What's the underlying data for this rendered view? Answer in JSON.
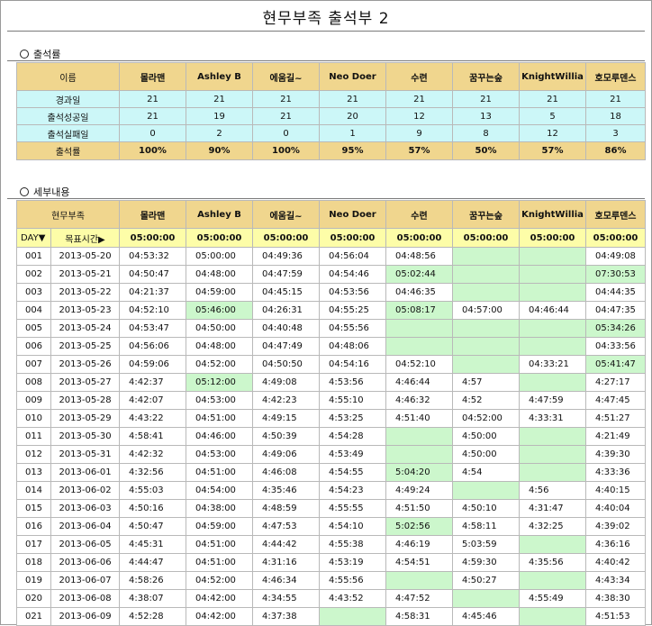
{
  "page_title": "현무부족 출석부 2",
  "colors": {
    "header": "#f0d68e",
    "cyan": "#ccf7f8",
    "goal": "#fdfda8",
    "green": "#ccf7cc"
  },
  "attendance": {
    "heading": "출석률",
    "name_header": "이름",
    "members": [
      "몰라맨",
      "Ashley B",
      "에움길~",
      "Neo Doer",
      "수련",
      "꿈꾸는숲",
      "KnightWillia",
      "호모루덴스"
    ],
    "rows": [
      {
        "label": "경과일",
        "values": [
          "21",
          "21",
          "21",
          "21",
          "21",
          "21",
          "21",
          "21"
        ]
      },
      {
        "label": "출석성공일",
        "values": [
          "21",
          "19",
          "21",
          "20",
          "12",
          "13",
          "5",
          "18"
        ]
      },
      {
        "label": "출석실패일",
        "values": [
          "0",
          "2",
          "0",
          "1",
          "9",
          "8",
          "12",
          "3"
        ]
      }
    ],
    "rate_label": "출석률",
    "rates": [
      "100%",
      "90%",
      "100%",
      "95%",
      "57%",
      "50%",
      "57%",
      "86%"
    ]
  },
  "detail": {
    "heading": "세부내용",
    "group_header": "현무부족",
    "members": [
      "몰라맨",
      "Ashley B",
      "에움길~",
      "Neo Doer",
      "수련",
      "꿈꾸는숲",
      "KnightWillia",
      "호모루덴스"
    ],
    "day_label": "DAY▼",
    "goal_label": "목표시간▶",
    "goal_times": [
      "05:00:00",
      "05:00:00",
      "05:00:00",
      "05:00:00",
      "05:00:00",
      "05:00:00",
      "05:00:00",
      "05:00:00"
    ],
    "rows": [
      {
        "day": "001",
        "date": "2013-05-20",
        "times": [
          "04:53:32",
          "05:00:00",
          "04:49:36",
          "04:56:04",
          "04:48:56",
          "",
          "",
          "04:49:08"
        ],
        "green": [
          5,
          6
        ]
      },
      {
        "day": "002",
        "date": "2013-05-21",
        "times": [
          "04:50:47",
          "04:48:00",
          "04:47:59",
          "04:54:46",
          "05:02:44",
          "",
          "",
          "07:30:53"
        ],
        "green": [
          4,
          5,
          6,
          7
        ]
      },
      {
        "day": "003",
        "date": "2013-05-22",
        "times": [
          "04:21:37",
          "04:59:00",
          "04:45:15",
          "04:53:56",
          "04:46:35",
          "",
          "",
          "04:44:35"
        ],
        "green": [
          5,
          6
        ]
      },
      {
        "day": "004",
        "date": "2013-05-23",
        "times": [
          "04:52:10",
          "05:46:00",
          "04:26:31",
          "04:55:25",
          "05:08:17",
          "04:57:00",
          "04:46:44",
          "04:47:35"
        ],
        "green": [
          1,
          4
        ]
      },
      {
        "day": "005",
        "date": "2013-05-24",
        "times": [
          "04:53:47",
          "04:50:00",
          "04:40:48",
          "04:55:56",
          "",
          "",
          "",
          "05:34:26"
        ],
        "green": [
          4,
          5,
          6,
          7
        ]
      },
      {
        "day": "006",
        "date": "2013-05-25",
        "times": [
          "04:56:06",
          "04:48:00",
          "04:47:49",
          "04:48:06",
          "",
          "",
          "",
          "04:33:56"
        ],
        "green": [
          4,
          5,
          6
        ]
      },
      {
        "day": "007",
        "date": "2013-05-26",
        "times": [
          "04:59:06",
          "04:52:00",
          "04:50:50",
          "04:54:16",
          "04:52:10",
          "",
          "04:33:21",
          "05:41:47"
        ],
        "green": [
          5,
          7
        ]
      },
      {
        "day": "008",
        "date": "2013-05-27",
        "times": [
          "4:42:37",
          "05:12:00",
          "4:49:08",
          "4:53:56",
          "4:46:44",
          "4:57",
          "",
          "4:27:17"
        ],
        "green": [
          1,
          6
        ]
      },
      {
        "day": "009",
        "date": "2013-05-28",
        "times": [
          "4:42:07",
          "04:53:00",
          "4:42:23",
          "4:55:10",
          "4:46:32",
          "4:52",
          "4:47:59",
          "4:47:45"
        ],
        "green": []
      },
      {
        "day": "010",
        "date": "2013-05-29",
        "times": [
          "4:43:22",
          "04:51:00",
          "4:49:15",
          "4:53:25",
          "4:51:40",
          "04:52:00",
          "4:33:31",
          "4:51:27"
        ],
        "green": []
      },
      {
        "day": "011",
        "date": "2013-05-30",
        "times": [
          "4:58:41",
          "04:46:00",
          "4:50:39",
          "4:54:28",
          "",
          "4:50:00",
          "",
          "4:21:49"
        ],
        "green": [
          4,
          6
        ]
      },
      {
        "day": "012",
        "date": "2013-05-31",
        "times": [
          "4:42:32",
          "04:53:00",
          "4:49:06",
          "4:53:49",
          "",
          "4:50:00",
          "",
          "4:39:30"
        ],
        "green": [
          4,
          6
        ]
      },
      {
        "day": "013",
        "date": "2013-06-01",
        "times": [
          "4:32:56",
          "04:51:00",
          "4:46:08",
          "4:54:55",
          "5:04:20",
          "4:54",
          "",
          "4:33:36"
        ],
        "green": [
          4,
          6
        ]
      },
      {
        "day": "014",
        "date": "2013-06-02",
        "times": [
          "4:55:03",
          "04:54:00",
          "4:35:46",
          "4:54:23",
          "4:49:24",
          "",
          "4:56",
          "4:40:15"
        ],
        "green": [
          5
        ]
      },
      {
        "day": "015",
        "date": "2013-06-03",
        "times": [
          "4:50:16",
          "04:38:00",
          "4:48:59",
          "4:55:55",
          "4:51:50",
          "4:50:10",
          "4:31:47",
          "4:40:04"
        ],
        "green": []
      },
      {
        "day": "016",
        "date": "2013-06-04",
        "times": [
          "4:50:47",
          "04:59:00",
          "4:47:53",
          "4:54:10",
          "5:02:56",
          "4:58:11",
          "4:32:25",
          "4:39:02"
        ],
        "green": [
          4
        ]
      },
      {
        "day": "017",
        "date": "2013-06-05",
        "times": [
          "4:45:31",
          "04:51:00",
          "4:44:42",
          "4:55:38",
          "4:46:19",
          "5:03:59",
          "",
          "4:36:16"
        ],
        "green": [
          6
        ]
      },
      {
        "day": "018",
        "date": "2013-06-06",
        "times": [
          "4:44:47",
          "04:51:00",
          "4:31:16",
          "4:53:19",
          "4:54:51",
          "4:59:30",
          "4:35:56",
          "4:40:42"
        ],
        "green": []
      },
      {
        "day": "019",
        "date": "2013-06-07",
        "times": [
          "4:58:26",
          "04:52:00",
          "4:46:34",
          "4:55:56",
          "",
          "4:50:27",
          "",
          "4:43:34"
        ],
        "green": [
          4,
          6
        ]
      },
      {
        "day": "020",
        "date": "2013-06-08",
        "times": [
          "4:38:07",
          "04:42:00",
          "4:34:55",
          "4:43:52",
          "4:47:52",
          "",
          "4:55:49",
          "4:38:30"
        ],
        "green": [
          5
        ]
      },
      {
        "day": "021",
        "date": "2013-06-09",
        "times": [
          "4:52:28",
          "04:42:00",
          "4:37:38",
          "",
          "4:58:31",
          "4:45:46",
          "",
          "4:51:53"
        ],
        "green": [
          3,
          6
        ]
      }
    ]
  }
}
